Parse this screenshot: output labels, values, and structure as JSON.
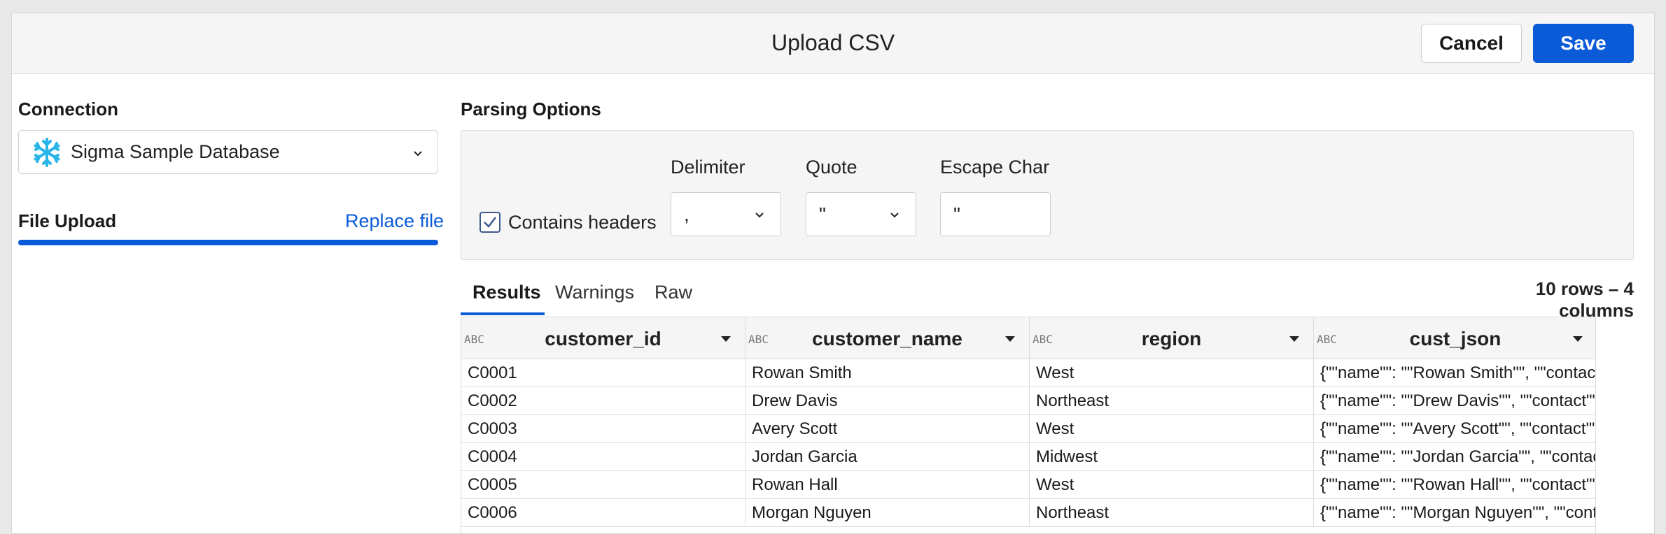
{
  "dialog": {
    "title": "Upload CSV",
    "cancel_label": "Cancel",
    "save_label": "Save"
  },
  "connection": {
    "section_label": "Connection",
    "selected": "Sigma Sample Database",
    "icon": "snowflake-icon"
  },
  "file_upload": {
    "section_label": "File Upload",
    "replace_label": "Replace file",
    "progress_fraction": 1.0
  },
  "parsing": {
    "section_label": "Parsing Options",
    "contains_headers_label": "Contains headers",
    "contains_headers_checked": true,
    "delimiter": {
      "label": "Delimiter",
      "value": ","
    },
    "quote": {
      "label": "Quote",
      "value": "\""
    },
    "escape": {
      "label": "Escape Char",
      "value": "\""
    }
  },
  "preview": {
    "tabs": [
      {
        "label": "Results",
        "active": true
      },
      {
        "label": "Warnings",
        "active": false
      },
      {
        "label": "Raw",
        "active": false
      }
    ],
    "summary": "10 rows – 4 columns",
    "columns": [
      {
        "type": "ABC",
        "name": "customer_id"
      },
      {
        "type": "ABC",
        "name": "customer_name"
      },
      {
        "type": "ABC",
        "name": "region"
      },
      {
        "type": "ABC",
        "name": "cust_json"
      }
    ],
    "rows": [
      [
        "C0001",
        "Rowan Smith",
        "West",
        "{\"\"name\"\": \"\"Rowan Smith\"\", \"\"contact\"\""
      ],
      [
        "C0002",
        "Drew Davis",
        "Northeast",
        "{\"\"name\"\": \"\"Drew Davis\"\", \"\"contact\"\": {"
      ],
      [
        "C0003",
        "Avery Scott",
        "West",
        "{\"\"name\"\": \"\"Avery Scott\"\", \"\"contact\"\": {"
      ],
      [
        "C0004",
        "Jordan Garcia",
        "Midwest",
        "{\"\"name\"\": \"\"Jordan Garcia\"\", \"\"contact\"\""
      ],
      [
        "C0005",
        "Rowan Hall",
        "West",
        "{\"\"name\"\": \"\"Rowan Hall\"\", \"\"contact\"\": {"
      ],
      [
        "C0006",
        "Morgan Nguyen",
        "Northeast",
        "{\"\"name\"\": \"\"Morgan Nguyen\"\", \"\"contac"
      ]
    ]
  }
}
